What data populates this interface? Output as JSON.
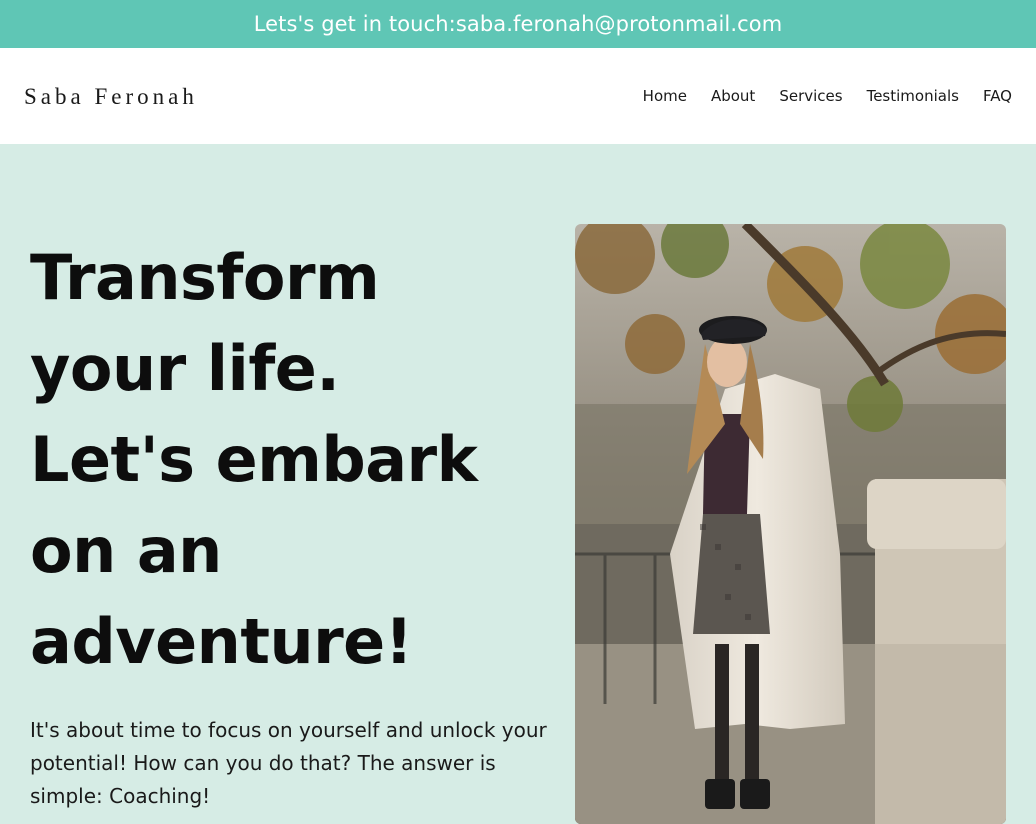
{
  "topbar": {
    "prefix": "Lets's get in touch: ",
    "email": "saba.feronah@protonmail.com"
  },
  "header": {
    "brand": "Saba Feronah",
    "nav": [
      "Home",
      "About",
      "Services",
      "Testimonials",
      "FAQ"
    ]
  },
  "hero": {
    "headline_lines": [
      "Transform",
      "your life.",
      "Let's embark",
      "on an",
      "adventure!"
    ],
    "intro": "It's about time to focus on yourself and unlock your potential! How can you do that? The answer is simple: Coaching!",
    "photo_description": "woman-in-white-coat-photo"
  },
  "colors": {
    "topbar": "#5fc6b5",
    "hero_bg": "#d6ece5",
    "text": "#0d0d0d"
  }
}
